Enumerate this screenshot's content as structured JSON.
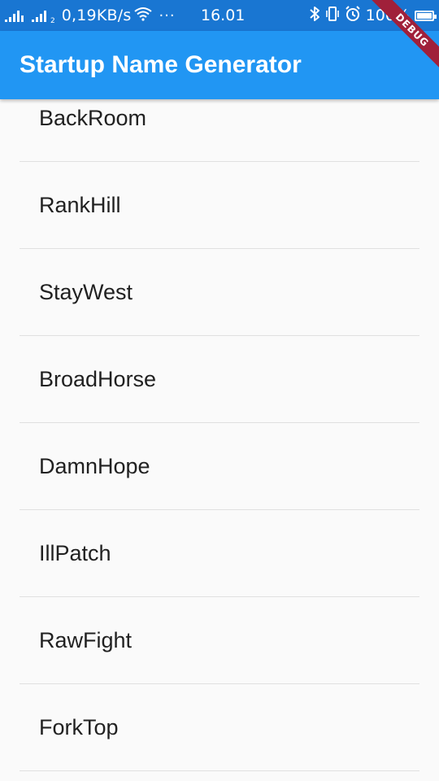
{
  "status_bar": {
    "network_speed": "0,19KB/s",
    "overflow": "···",
    "time": "16.01",
    "battery_percent": "100%",
    "sim_tag": "2",
    "color": "#1976d2"
  },
  "app_bar": {
    "title": "Startup Name Generator",
    "color": "#2196f3"
  },
  "debug_banner": {
    "label": "DEBUG"
  },
  "list": {
    "items": [
      "BackRoom",
      "RankHill",
      "StayWest",
      "BroadHorse",
      "DamnHope",
      "IllPatch",
      "RawFight",
      "ForkTop"
    ]
  }
}
